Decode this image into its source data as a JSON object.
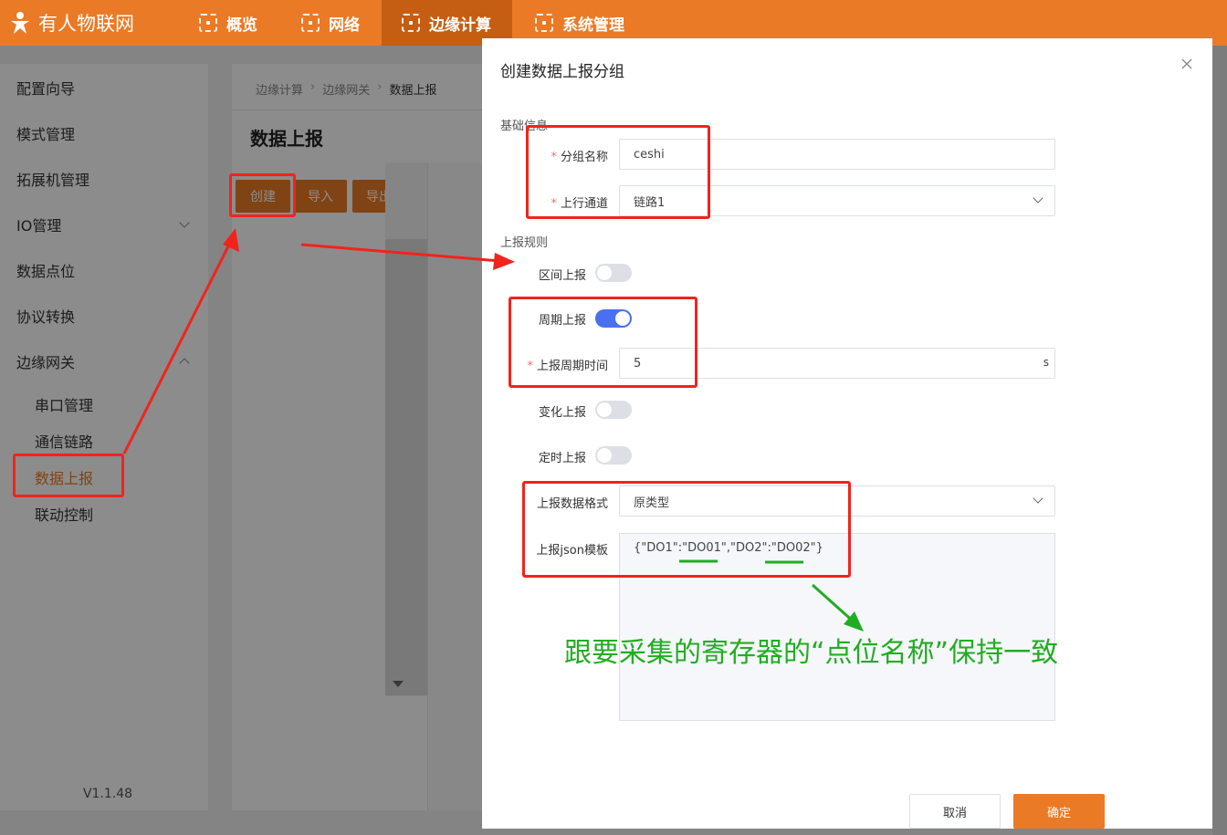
{
  "topbar": {
    "brand": "有人物联网",
    "nav": [
      "概览",
      "网络",
      "边缘计算",
      "系统管理"
    ],
    "active_nav": "边缘计算"
  },
  "sidebar": {
    "items": [
      "配置向导",
      "模式管理",
      "拓展机管理",
      "IO管理",
      "数据点位",
      "协议转换",
      "边缘网关"
    ],
    "sub_items": [
      "串口管理",
      "通信链路",
      "数据上报",
      "联动控制"
    ],
    "active_sub": "数据上报",
    "version": "V1.1.48"
  },
  "main": {
    "breadcrumb": [
      "边缘计算",
      "边缘网关",
      "数据上报"
    ],
    "title": "数据上报",
    "buttons": {
      "create": "创建",
      "import": "导入",
      "export": "导出"
    }
  },
  "dialog": {
    "title": "创建数据上报分组",
    "section_basic": "基础信息",
    "section_rules": "上报规则",
    "fields": {
      "group_name_label": "分组名称",
      "group_name_value": "ceshi",
      "channel_label": "上行通道",
      "channel_value": "链路1",
      "interval_label": "区间上报",
      "periodic_label": "周期上报",
      "period_time_label": "上报周期时间",
      "period_time_value": "5",
      "period_time_unit": "s",
      "change_label": "变化上报",
      "timed_label": "定时上报",
      "format_label": "上报数据格式",
      "format_value": "原类型",
      "json_label": "上报json模板",
      "json_value": "{\"DO1\":\"DO01\",\"DO2\":\"DO02\"}"
    },
    "switches": {
      "interval": false,
      "periodic": true,
      "change": false,
      "timed": false
    },
    "buttons": {
      "cancel": "取消",
      "ok": "确定"
    }
  },
  "annotation": {
    "note": "跟要采集的寄存器的“点位名称”保持一致"
  },
  "colors": {
    "accent": "#ea7a26",
    "switch_on": "#4a6ff0",
    "annotation_red": "#f2231c",
    "annotation_green": "#21ad21"
  }
}
